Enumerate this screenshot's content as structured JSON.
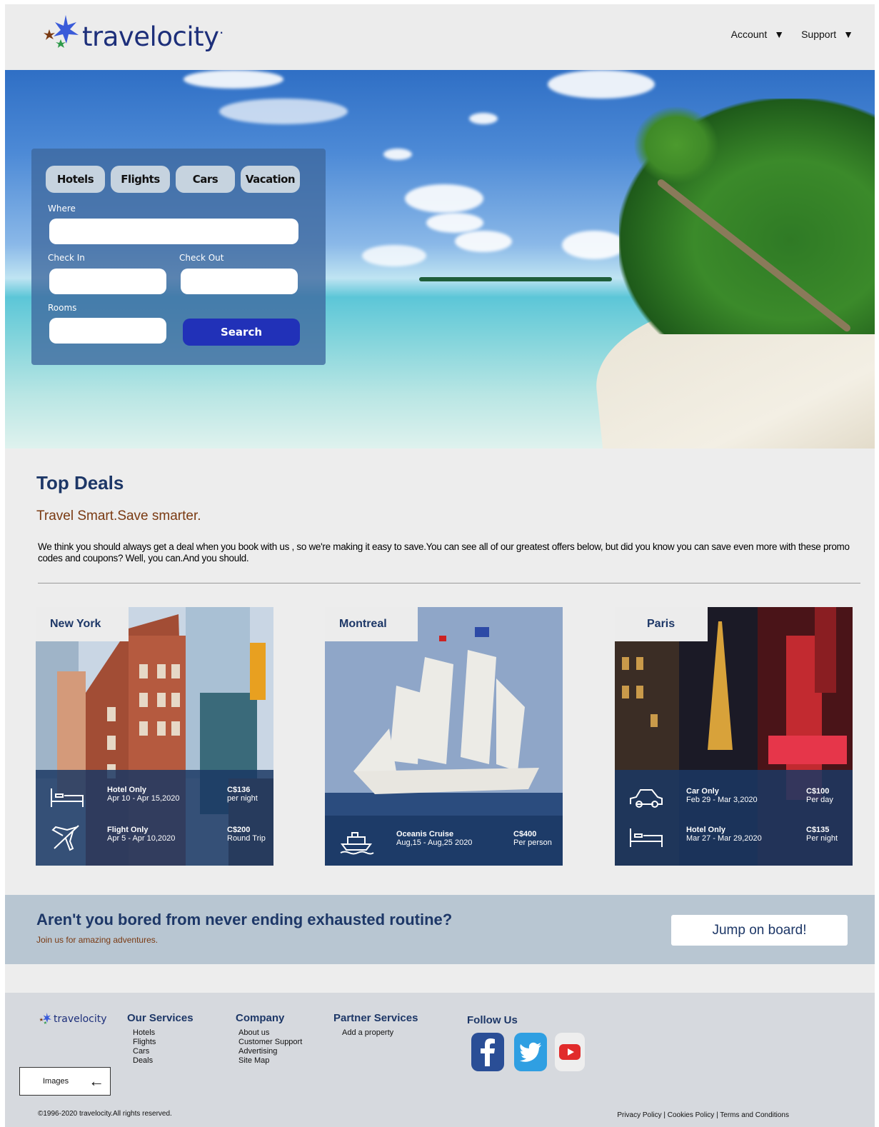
{
  "header": {
    "brand": "travelocity",
    "brand_mark": "·",
    "nav": [
      {
        "label": "Account",
        "icon": "caret-down-icon"
      },
      {
        "label": "Support",
        "icon": "caret-down-icon"
      }
    ]
  },
  "search": {
    "tabs": [
      "Hotels",
      "Flights",
      "Cars",
      "Vacation"
    ],
    "where_label": "Where",
    "check_in_label": "Check In",
    "check_out_label": "Check Out",
    "rooms_label": "Rooms",
    "where_value": "",
    "check_in_value": "",
    "check_out_value": "",
    "rooms_value": "",
    "button": "Search"
  },
  "deals": {
    "title": "Top Deals",
    "subtitle": "Travel Smart.Save smarter.",
    "text": "We think you should always get a deal when you book with us , so we're making it easy to save.You can see all of our greatest offers below, but did you know you can save even more with these promo codes and coupons? Well, you can.And you should.",
    "cards": [
      {
        "city": "New York",
        "items": [
          {
            "icon": "bed-icon",
            "name": "Hotel Only",
            "dates": "Apr 10 - Apr 15,2020",
            "price": "C$136",
            "unit": "per night"
          },
          {
            "icon": "plane-icon",
            "name": "Flight Only",
            "dates": "Apr 5 - Apr 10,2020",
            "price": "C$200",
            "unit": "Round Trip"
          }
        ]
      },
      {
        "city": "Montreal",
        "items": [
          {
            "icon": "ship-icon",
            "name": "Oceanis Cruise",
            "dates": "Aug,15 - Aug,25 2020",
            "price": "C$400",
            "unit": "Per person"
          }
        ]
      },
      {
        "city": "Paris",
        "items": [
          {
            "icon": "car-icon",
            "name": "Car Only",
            "dates": "Feb 29 - Mar 3,2020",
            "price": "C$100",
            "unit": "Per day"
          },
          {
            "icon": "bed-icon",
            "name": "Hotel Only",
            "dates": "Mar 27 - Mar 29,2020",
            "price": "C$135",
            "unit": "Per night"
          }
        ]
      }
    ]
  },
  "banner": {
    "title": "Aren't you bored from never ending exhausted routine?",
    "subtitle": "Join us for amazing adventures.",
    "button": "Jump on board!"
  },
  "footer": {
    "brand": "travelocity",
    "columns": [
      {
        "title": "Our Services",
        "links": [
          "Hotels",
          "Flights",
          "Cars",
          "Deals"
        ]
      },
      {
        "title": "Company",
        "links": [
          "About us",
          "Customer Support",
          "Advertising",
          "Site Map"
        ]
      },
      {
        "title": "Partner Services",
        "links": [
          "Add a property"
        ]
      },
      {
        "title": "Follow Us",
        "links": []
      }
    ],
    "social": [
      "facebook-icon",
      "twitter-icon",
      "youtube-icon"
    ],
    "images_button": "Images",
    "copyright": "©1996-2020 travelocity.All rights reserved.",
    "legal": "Privacy Policy | Cookies Policy | Terms and Conditions"
  },
  "colors": {
    "brand_navy": "#1d3767",
    "accent_brown": "#7a3a12",
    "search_blue": "#2131b8",
    "banner_bg": "#b8c6d2"
  }
}
